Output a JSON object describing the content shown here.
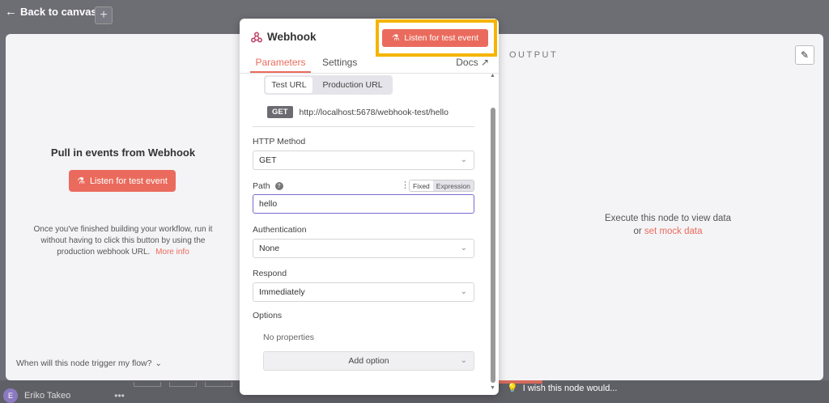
{
  "background": {
    "back_label": "Back to canvas",
    "add_icon": "+",
    "user_initial": "E",
    "user_name": "Eriko Takeo",
    "user_menu": "•••",
    "wish_text": "I wish this node would..."
  },
  "input_panel": {
    "title": "Pull in events from Webhook",
    "listen_label": "Listen for test event",
    "description": "Once you've finished building your workflow, run it without having to click this button by using the production webhook URL.",
    "more_info": "More info",
    "trigger_question": "When will this node trigger my flow?"
  },
  "output_panel": {
    "label": "OUTPUT",
    "empty_message": "Execute this node to view data",
    "or_text": "or",
    "mock_link": "set mock data"
  },
  "node": {
    "title": "Webhook",
    "listen_label": "Listen for test event",
    "tabs": [
      {
        "label": "Parameters",
        "active": true
      },
      {
        "label": "Settings",
        "active": false
      }
    ],
    "docs_label": "Docs",
    "url_toggle": {
      "test": "Test URL",
      "production": "Production URL"
    },
    "method_badge": "GET",
    "webhook_url": "http://localhost:5678/webhook-test/hello",
    "http_method": {
      "label": "HTTP Method",
      "value": "GET"
    },
    "path": {
      "label": "Path",
      "value": "hello",
      "help": "?",
      "fixed": "Fixed",
      "expression": "Expression"
    },
    "authentication": {
      "label": "Authentication",
      "value": "None"
    },
    "respond": {
      "label": "Respond",
      "value": "Immediately"
    },
    "options": {
      "label": "Options",
      "empty": "No properties",
      "add_label": "Add option"
    }
  },
  "colors": {
    "accent": "#ea6b5d",
    "highlight": "#f5b400",
    "focus": "#7a6bd4"
  }
}
